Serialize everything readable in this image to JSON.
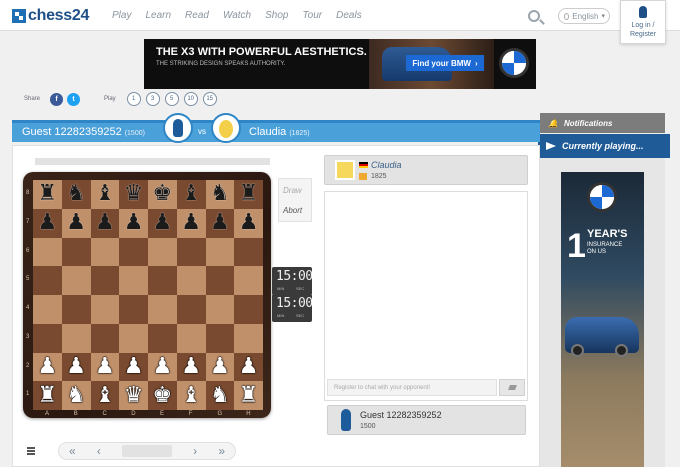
{
  "header": {
    "logo_text": "chess24",
    "nav": [
      "Play",
      "Learn",
      "Read",
      "Watch",
      "Shop",
      "Tour",
      "Deals"
    ],
    "language": "English",
    "login_line1": "Log in /",
    "login_line2": "Register"
  },
  "banner": {
    "headline": "THE X3 WITH POWERFUL AESTHETICS.",
    "subline": "THE STRIKING DESIGN SPEAKS AUTHORITY.",
    "cta": "Find your BMW",
    "cta_arrow": "›"
  },
  "share": {
    "label": "Share",
    "facebook": "f",
    "twitter": "t"
  },
  "play": {
    "label": "Play",
    "time_controls": [
      "1",
      "3",
      "5",
      "10",
      "15"
    ]
  },
  "players": {
    "white_name": "Guest 12282359252",
    "white_rating": "(1500)",
    "vs": "vs",
    "black_name": "Claudia",
    "black_rating": "(1825)"
  },
  "right_panel": {
    "notifications": "Notifications",
    "currently_playing": "Currently playing..."
  },
  "right_ad": {
    "big": "1",
    "year": "YEAR'S",
    "insurance_line1": "INSURANCE",
    "insurance_line2": "ON US"
  },
  "board": {
    "ranks": [
      "8",
      "7",
      "6",
      "5",
      "4",
      "3",
      "2",
      "1"
    ],
    "files": [
      "A",
      "B",
      "C",
      "D",
      "E",
      "F",
      "G",
      "H"
    ],
    "rank8": [
      "♜",
      "♞",
      "♝",
      "♛",
      "♚",
      "♝",
      "♞",
      "♜"
    ],
    "rank7": [
      "♟",
      "♟",
      "♟",
      "♟",
      "♟",
      "♟",
      "♟",
      "♟"
    ],
    "rank2": [
      "♟",
      "♟",
      "♟",
      "♟",
      "♟",
      "♟",
      "♟",
      "♟"
    ],
    "rank1": [
      "♜",
      "♞",
      "♝",
      "♛",
      "♚",
      "♝",
      "♞",
      "♜"
    ]
  },
  "actions": {
    "draw": "Draw",
    "abort": "Abort"
  },
  "clocks": {
    "top_time": "15:00",
    "bottom_time": "15:00",
    "unit_min": "MIN",
    "unit_sec": "SEC"
  },
  "opponent_card": {
    "name": "Claudia",
    "rating": "1825"
  },
  "chat": {
    "placeholder": "Register to chat with your opponent!"
  },
  "me_card": {
    "name": "Guest 12282359252",
    "rating": "1500"
  },
  "move_nav": {
    "first": "«",
    "prev": "‹",
    "next": "›",
    "last": "»"
  },
  "colors": {
    "player_bar": "#4aa0d9",
    "currently_playing": "#1f5c97",
    "notifications": "#7c7c7c",
    "board_light": "#c0906a",
    "board_dark": "#7a4a30"
  }
}
